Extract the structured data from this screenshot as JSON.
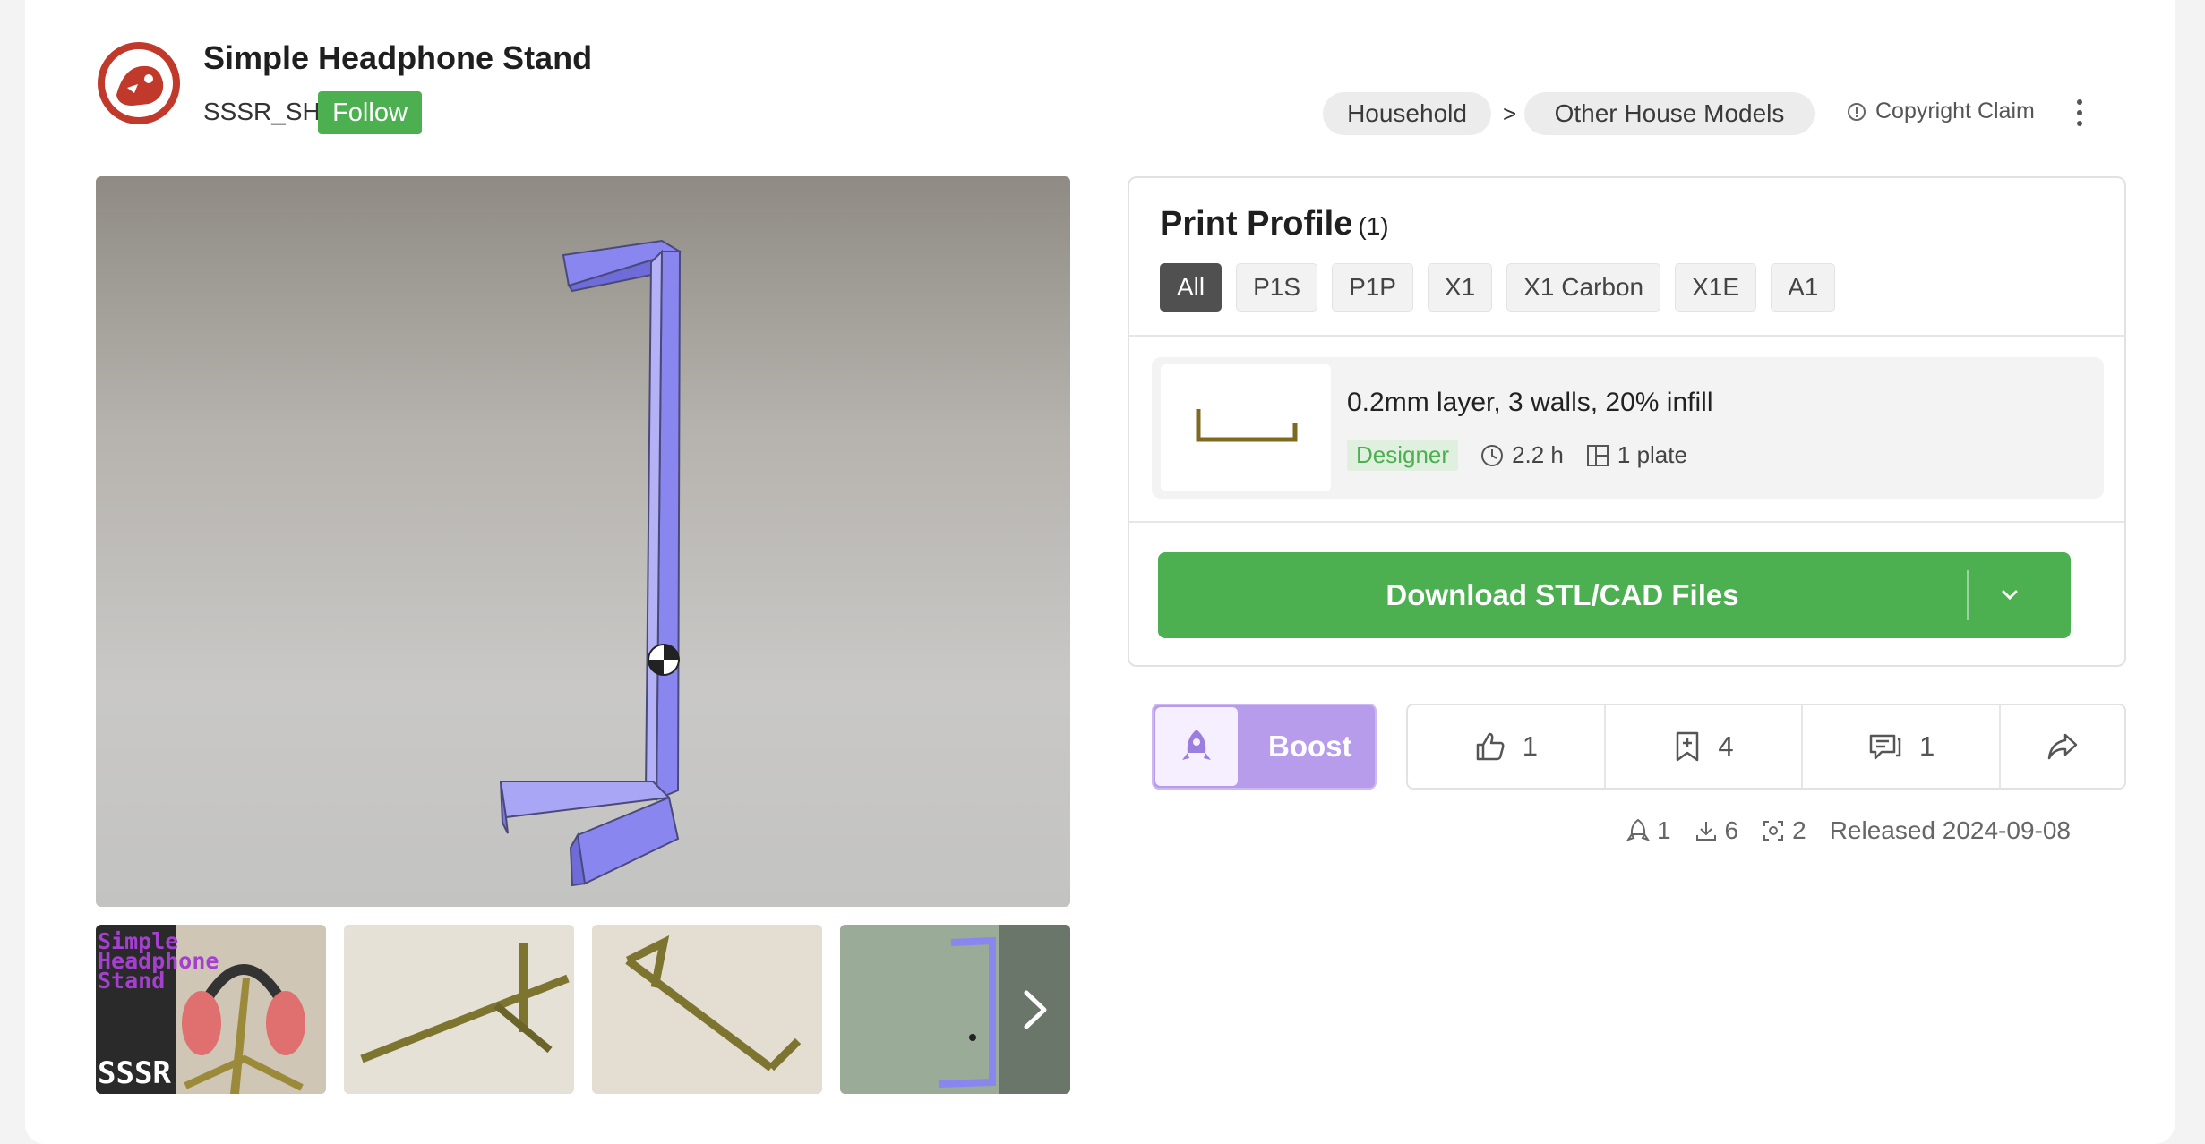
{
  "model": {
    "title": "Simple Headphone Stand",
    "author": "SSSR_SH",
    "follow_label": "Follow"
  },
  "breadcrumb": {
    "items": [
      "Household",
      "Other House Models"
    ],
    "separator": ">"
  },
  "copyright_label": "Copyright Claim",
  "thumbnails": {
    "first_overlay_text": [
      "Simple",
      "Headphone",
      "Stand"
    ],
    "first_logo": "SSSR"
  },
  "print_profile": {
    "title": "Print Profile",
    "count": "(1)",
    "filters": [
      "All",
      "P1S",
      "P1P",
      "X1",
      "X1 Carbon",
      "X1E",
      "A1"
    ],
    "active_filter": "All",
    "profile": {
      "name": "0.2mm layer, 3 walls, 20% infill",
      "tag": "Designer",
      "time": "2.2 h",
      "plates": "1 plate"
    },
    "download_label": "Download STL/CAD Files"
  },
  "actions": {
    "boost_label": "Boost",
    "likes": "1",
    "collects": "4",
    "comments": "1"
  },
  "stats": {
    "boosts": "1",
    "downloads": "6",
    "prints": "2",
    "released": "Released 2024-09-08"
  },
  "colors": {
    "brand_green": "#4caf50",
    "boost_purple": "#b89cec",
    "model_blue": "#8a86f0"
  },
  "icons": {
    "copyright": "info-circle-icon",
    "more": "more-vertical-icon",
    "next": "chevron-right-icon",
    "download_dropdown": "chevron-down-icon",
    "boost": "rocket-icon",
    "like": "thumbs-up-icon",
    "collect": "bookmark-plus-icon",
    "comment": "comment-icon",
    "share": "share-icon",
    "time": "clock-icon",
    "plate": "plate-icon",
    "download_stat": "download-icon",
    "print_stat": "print-scan-icon"
  }
}
